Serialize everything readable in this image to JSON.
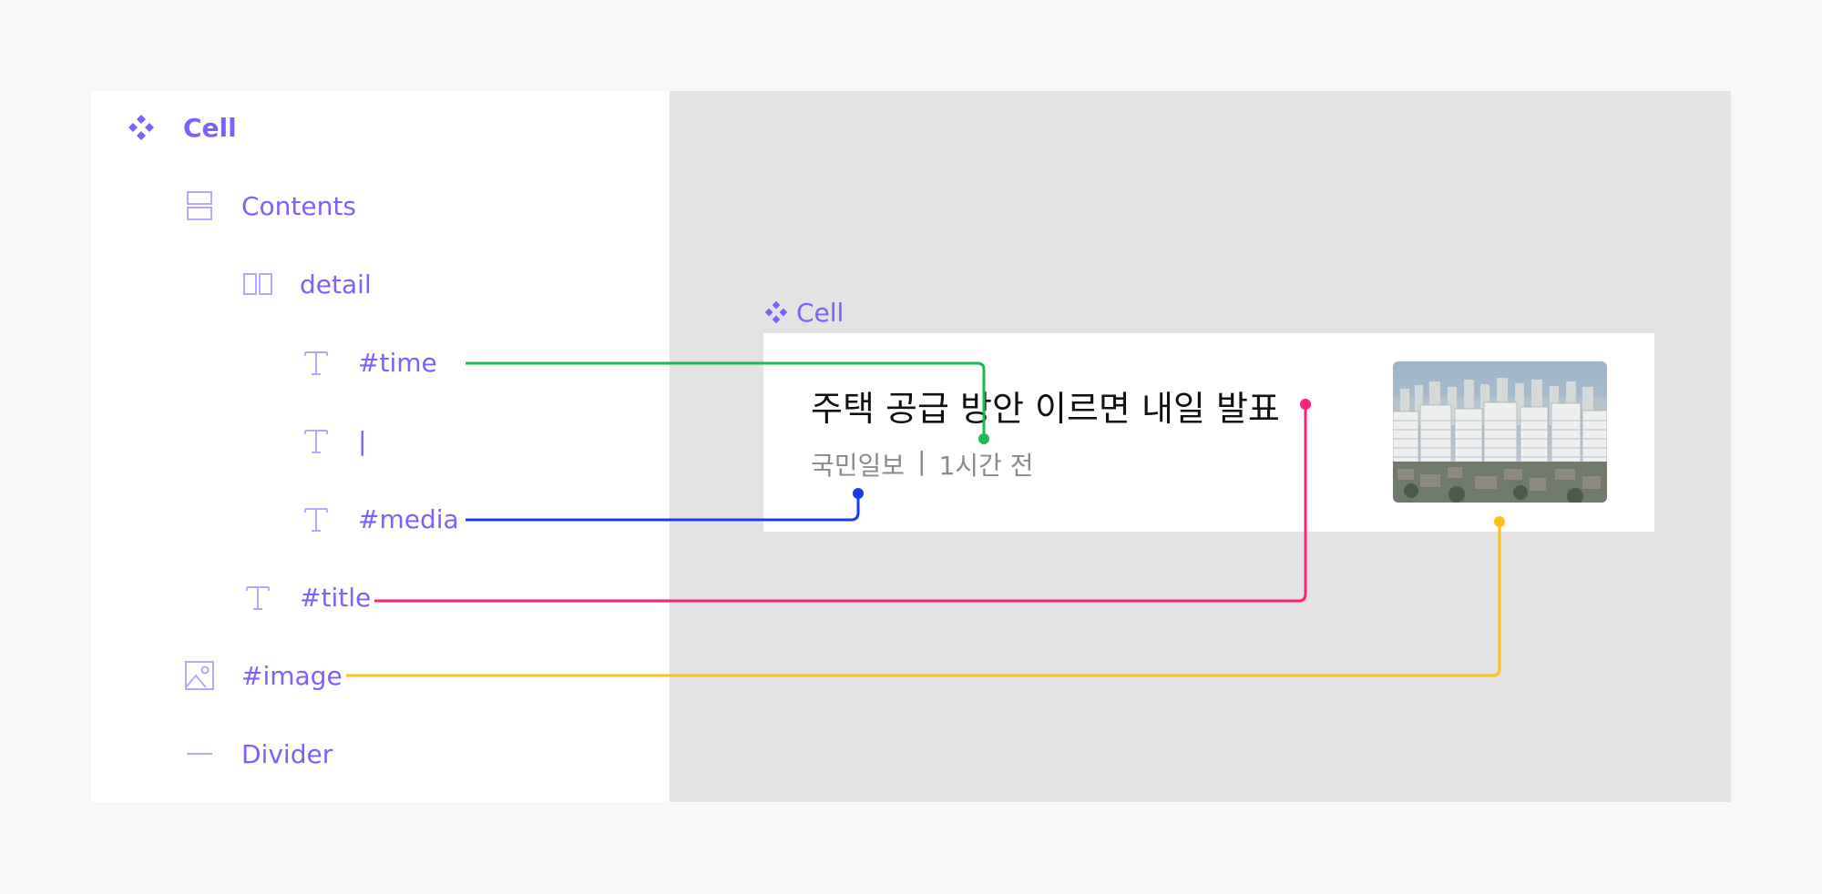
{
  "layers_panel": {
    "items": [
      {
        "id": "cell",
        "label": "Cell",
        "icon": "component-icon"
      },
      {
        "id": "contents",
        "label": "Contents",
        "icon": "vertical-stack-icon"
      },
      {
        "id": "detail",
        "label": "detail",
        "icon": "horizontal-stack-icon"
      },
      {
        "id": "time",
        "label": "#time",
        "icon": "text-icon"
      },
      {
        "id": "divider-text",
        "label": "|",
        "icon": "text-icon"
      },
      {
        "id": "media",
        "label": "#media",
        "icon": "text-icon"
      },
      {
        "id": "title",
        "label": "#title",
        "icon": "text-icon"
      },
      {
        "id": "image",
        "label": "#image",
        "icon": "image-icon"
      },
      {
        "id": "divider",
        "label": "Divider",
        "icon": "line-icon"
      }
    ]
  },
  "preview": {
    "frame_label": "Cell",
    "title": "주택 공급 방안 이르면 내일 발표",
    "media": "국민일보",
    "separator": "|",
    "time": "1시간 전",
    "image_alt": "city-apartments-photo"
  },
  "colors": {
    "accent": "#7b61ff",
    "time_link": "#1db954",
    "media_link": "#1a3cf0",
    "title_link": "#ff1f7a",
    "image_link": "#ffbf1f"
  }
}
